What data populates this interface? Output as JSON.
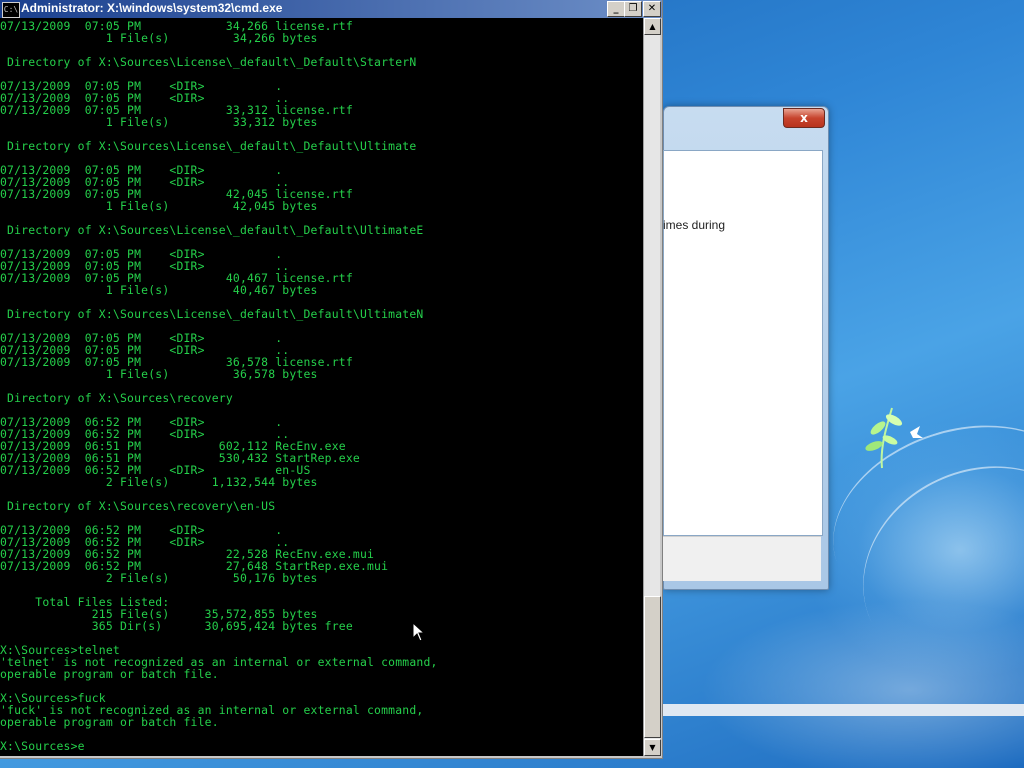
{
  "cmd_window": {
    "title": "Administrator: X:\\windows\\system32\\cmd.exe",
    "icon": "C:\\",
    "buttons": {
      "minimize": "_",
      "maximize": "❐",
      "close": "✕"
    },
    "console_lines": [
      "07/13/2009  07:05 PM            34,266 license.rtf",
      "               1 File(s)         34,266 bytes",
      "",
      " Directory of X:\\Sources\\License\\_default\\_Default\\StarterN",
      "",
      "07/13/2009  07:05 PM    <DIR>          .",
      "07/13/2009  07:05 PM    <DIR>          ..",
      "07/13/2009  07:05 PM            33,312 license.rtf",
      "               1 File(s)         33,312 bytes",
      "",
      " Directory of X:\\Sources\\License\\_default\\_Default\\Ultimate",
      "",
      "07/13/2009  07:05 PM    <DIR>          .",
      "07/13/2009  07:05 PM    <DIR>          ..",
      "07/13/2009  07:05 PM            42,045 license.rtf",
      "               1 File(s)         42,045 bytes",
      "",
      " Directory of X:\\Sources\\License\\_default\\_Default\\UltimateE",
      "",
      "07/13/2009  07:05 PM    <DIR>          .",
      "07/13/2009  07:05 PM    <DIR>          ..",
      "07/13/2009  07:05 PM            40,467 license.rtf",
      "               1 File(s)         40,467 bytes",
      "",
      " Directory of X:\\Sources\\License\\_default\\_Default\\UltimateN",
      "",
      "07/13/2009  07:05 PM    <DIR>          .",
      "07/13/2009  07:05 PM    <DIR>          ..",
      "07/13/2009  07:05 PM            36,578 license.rtf",
      "               1 File(s)         36,578 bytes",
      "",
      " Directory of X:\\Sources\\recovery",
      "",
      "07/13/2009  06:52 PM    <DIR>          .",
      "07/13/2009  06:52 PM    <DIR>          ..",
      "07/13/2009  06:51 PM           602,112 RecEnv.exe",
      "07/13/2009  06:51 PM           530,432 StartRep.exe",
      "07/13/2009  06:52 PM    <DIR>          en-US",
      "               2 File(s)      1,132,544 bytes",
      "",
      " Directory of X:\\Sources\\recovery\\en-US",
      "",
      "07/13/2009  06:52 PM    <DIR>          .",
      "07/13/2009  06:52 PM    <DIR>          ..",
      "07/13/2009  06:52 PM            22,528 RecEnv.exe.mui",
      "07/13/2009  06:52 PM            27,648 StartRep.exe.mui",
      "               2 File(s)         50,176 bytes",
      "",
      "     Total Files Listed:",
      "             215 File(s)     35,572,855 bytes",
      "             365 Dir(s)      30,695,424 bytes free",
      "",
      "X:\\Sources>telnet",
      "'telnet' is not recognized as an internal or external command,",
      "operable program or batch file.",
      "",
      "X:\\Sources>fuck",
      "'fuck' is not recognized as an internal or external command,",
      "operable program or batch file.",
      "",
      "X:\\Sources>e"
    ],
    "scrollbar": {
      "up_arrow": "▲",
      "down_arrow": "▼"
    }
  },
  "background_window": {
    "close_label": "x",
    "visible_text": "imes during"
  },
  "colors": {
    "console_text": "#25d04b",
    "console_bg": "#000000",
    "titlebar_start": "#1a3f8e",
    "titlebar_end": "#6d8fc7"
  }
}
